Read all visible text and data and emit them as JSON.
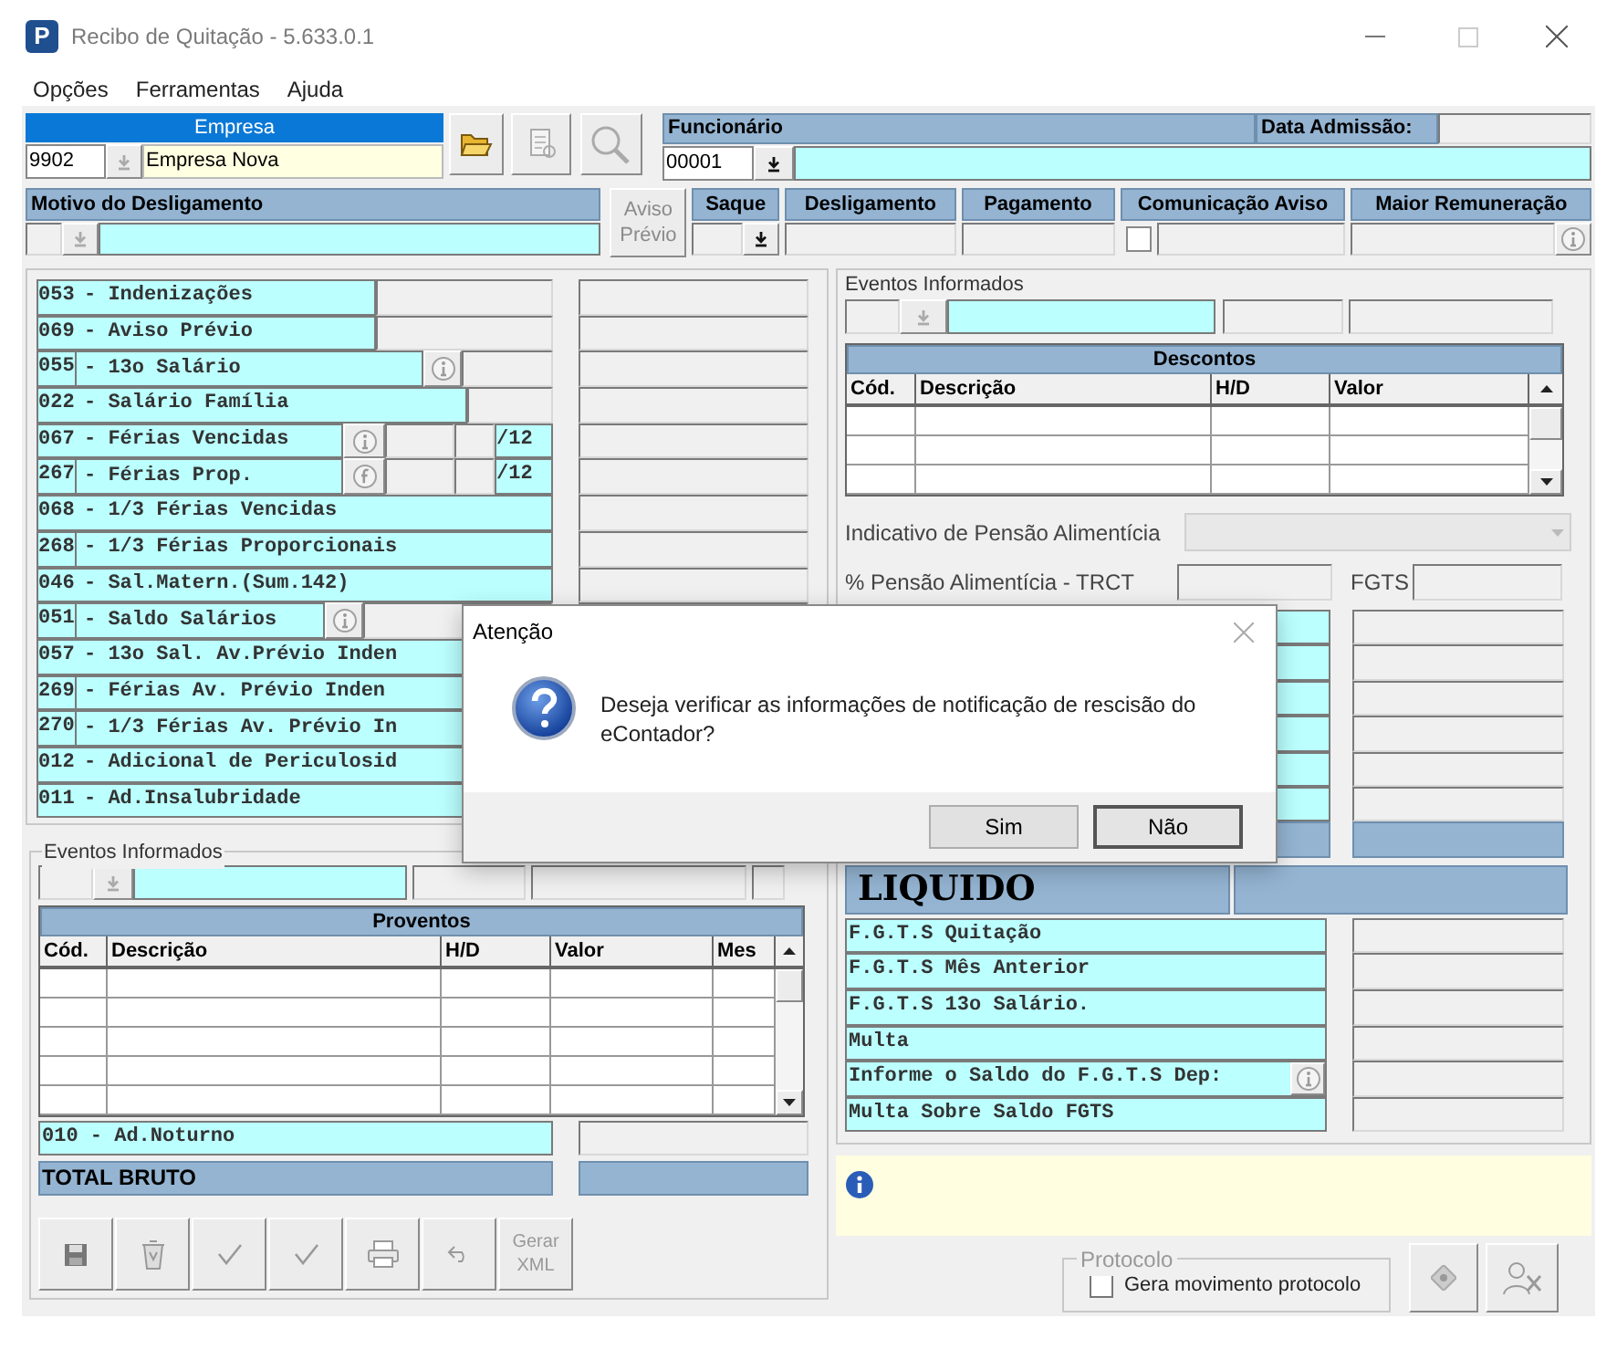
{
  "window": {
    "logo": "P",
    "title": "Recibo de Quitação - 5.633.0.1"
  },
  "menu": [
    "Opções",
    "Ferramentas",
    "Ajuda"
  ],
  "empresa": {
    "label": "Empresa",
    "code": "9902",
    "name": "Empresa Nova"
  },
  "funcionario": {
    "label": "Funcionário",
    "code": "00001",
    "admission_label": "Data Admissão:"
  },
  "motivo": {
    "label": "Motivo do Desligamento"
  },
  "aviso_button": {
    "label": "Aviso Prévio",
    "disabled": true
  },
  "header_fields": [
    {
      "label": "Saque",
      "kind": "lookup"
    },
    {
      "label": "Desligamento",
      "kind": "field"
    },
    {
      "label": "Pagamento",
      "kind": "field"
    },
    {
      "label": "Comunicação Aviso",
      "kind": "checkbox",
      "checked": false
    },
    {
      "label": "Maior Remuneração",
      "kind": "info"
    }
  ],
  "earnings": [
    {
      "code": "053",
      "label": "- Indenizações",
      "kind": "value",
      "divided": false
    },
    {
      "code": "069",
      "label": "- Aviso Prévio",
      "kind": "value",
      "divided": false
    },
    {
      "code": "055",
      "label": "- 13o Salário",
      "kind": "info",
      "divided": true
    },
    {
      "code": "022",
      "label": "- Salário Família",
      "kind": "family",
      "divided": false
    },
    {
      "code": "067",
      "label": "- Férias Vencidas",
      "kind": "fraction",
      "suffix": "/12",
      "divided": false
    },
    {
      "code": "267",
      "label": "- Férias Prop.",
      "kind": "fraction_formula",
      "suffix": "/12",
      "divided": true
    },
    {
      "code": "068",
      "label": "- 1/3 Férias Vencidas",
      "kind": "full",
      "divided": false
    },
    {
      "code": "268",
      "label": "- 1/3 Férias Proporcionais",
      "kind": "full",
      "divided": true
    },
    {
      "code": "046",
      "label": "- Sal.Matern.(Sum.142)",
      "kind": "full",
      "divided": false
    },
    {
      "code": "051",
      "label": "- Saldo Salários",
      "kind": "saldo",
      "divided": true
    },
    {
      "code": "057",
      "label": "- 13o Sal. Av.Prévio Inden",
      "kind": "full",
      "divided": false
    },
    {
      "code": "269",
      "label": "- Férias  Av. Prévio Inden",
      "kind": "full",
      "divided": true
    },
    {
      "code": "270",
      "label": "- 1/3 Férias Av. Prévio In",
      "kind": "full",
      "divided": true
    },
    {
      "code": "012",
      "label": "- Adicional de Periculosid",
      "kind": "full",
      "divided": false
    },
    {
      "code": "011",
      "label": "- Ad.Insalubridade",
      "kind": "full",
      "divided": false
    }
  ],
  "events_left": {
    "legend": "Eventos Informados"
  },
  "proventos": {
    "title": "Proventos",
    "columns": [
      "Cód.",
      "Descrição",
      "H/D",
      "Valor",
      "Mes"
    ]
  },
  "noturno": "010 - Ad.Noturno",
  "total": "TOTAL BRUTO",
  "toolbar": [
    {
      "kind": "save",
      "disabled": true
    },
    {
      "kind": "recycle",
      "disabled": true
    },
    {
      "kind": "check",
      "disabled": true
    },
    {
      "kind": "check",
      "disabled": true
    },
    {
      "kind": "print",
      "disabled": true
    },
    {
      "kind": "undo",
      "disabled": true
    },
    {
      "kind": "text",
      "label": "Gerar XML",
      "disabled": true
    }
  ],
  "events_right": {
    "legend": "Eventos Informados"
  },
  "descontos": {
    "title": "Descontos",
    "columns": [
      "Cód.",
      "Descrição",
      "H/D",
      "Valor"
    ]
  },
  "pensao": {
    "label": "Indicativo de Pensão Alimentícia",
    "disabled": true
  },
  "percent": {
    "label": "% Pensão Alimentícia - TRCT"
  },
  "fgts": {
    "label": "FGTS"
  },
  "liquido": "LIQUIDO",
  "fgts_rows": [
    {
      "label": "F.G.T.S  Quitação",
      "info": false
    },
    {
      "label": "F.G.T.S  Mês Anterior",
      "info": false
    },
    {
      "label": "F.G.T.S  13o Salário.",
      "info": false
    },
    {
      "label": "Multa",
      "info": false
    },
    {
      "label": "Informe o Saldo do F.G.T.S Dep:",
      "info": true
    },
    {
      "label": "Multa Sobre Saldo FGTS",
      "info": false
    }
  ],
  "protocolo": {
    "legend": "Protocolo",
    "checkbox_label": "Gera movimento protocolo",
    "checked": false
  },
  "dialog": {
    "title": "Atenção",
    "message": "Deseja verificar as informações de notificação de rescisão do eContador?",
    "buttons": [
      {
        "label": "Sim",
        "selected": false
      },
      {
        "label": "Não",
        "selected": true
      }
    ]
  }
}
